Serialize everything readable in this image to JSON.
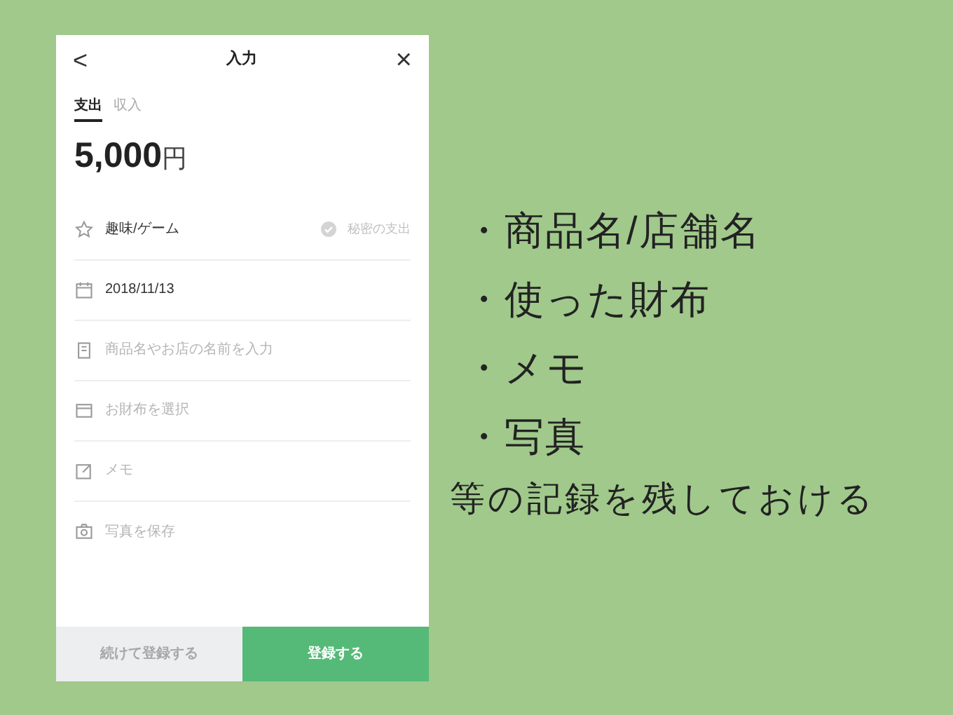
{
  "header": {
    "back": "<",
    "title": "入力",
    "close": "×"
  },
  "tabs": [
    {
      "label": "支出",
      "selected": true
    },
    {
      "label": "収入",
      "selected": false
    }
  ],
  "amount": {
    "value": "5,000",
    "unit": "円"
  },
  "rows": [
    {
      "kind": "category",
      "value": "趣味/ゲーム",
      "toggle": {
        "label": "秘密の支出",
        "checked": false
      }
    },
    {
      "kind": "date",
      "value": "2018/11/13"
    },
    {
      "kind": "name",
      "placeholder": "商品名やお店の名前を入力"
    },
    {
      "kind": "wallet",
      "placeholder": "お財布を選択"
    },
    {
      "kind": "memo",
      "placeholder": "メモ"
    },
    {
      "kind": "photo",
      "placeholder": "写真を保存"
    }
  ],
  "buttons": [
    {
      "label": "続けて登録する",
      "kind": "secondary"
    },
    {
      "label": "登録する",
      "kind": "primary"
    }
  ],
  "notes": {
    "bullets": [
      "商品名/店舗名",
      "使った財布",
      "メモ",
      "写真"
    ],
    "bullet_mark": "・",
    "caption": "等の記録を残しておける"
  }
}
